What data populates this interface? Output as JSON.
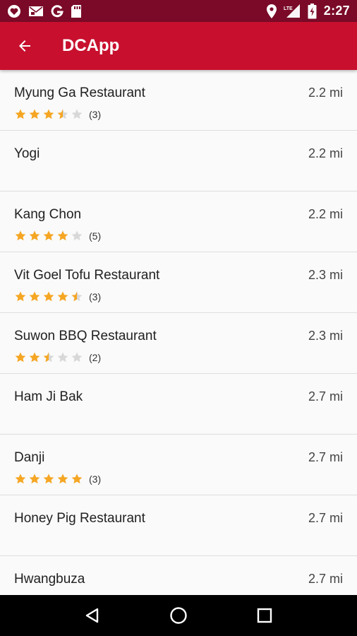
{
  "status_bar": {
    "time": "2:27",
    "network": "LTE",
    "icons_left": [
      "heart-notification-icon",
      "mail-icon",
      "google-icon",
      "sd-card-icon"
    ],
    "icons_right": [
      "location-icon",
      "lte-signal-icon",
      "battery-icon"
    ]
  },
  "app_bar": {
    "title": "DCApp",
    "back_icon": "arrow-left-icon"
  },
  "colors": {
    "status_bar": "#7a0a28",
    "app_bar": "#c8102e",
    "star_filled": "#f5a623",
    "star_empty": "#d8d8d8"
  },
  "restaurants": [
    {
      "name": "Myung Ga Restaurant",
      "distance": "2.2 mi",
      "rating": 3.5,
      "count": "(3)"
    },
    {
      "name": "Yogi",
      "distance": "2.2 mi"
    },
    {
      "name": "Kang Chon",
      "distance": "2.2 mi",
      "rating": 4,
      "count": "(5)"
    },
    {
      "name": "Vit Goel Tofu Restaurant",
      "distance": "2.3 mi",
      "rating": 4.5,
      "count": "(3)"
    },
    {
      "name": "Suwon BBQ Restaurant",
      "distance": "2.3 mi",
      "rating": 2.5,
      "count": "(2)"
    },
    {
      "name": "Ham Ji Bak",
      "distance": "2.7 mi"
    },
    {
      "name": "Danji",
      "distance": "2.7 mi",
      "rating": 5,
      "count": "(3)"
    },
    {
      "name": "Honey Pig Restaurant",
      "distance": "2.7 mi"
    },
    {
      "name": "Hwangbuza",
      "distance": "2.7 mi"
    }
  ],
  "nav_bar": {
    "buttons": [
      "back-triangle-icon",
      "home-circle-icon",
      "recents-square-icon"
    ]
  }
}
